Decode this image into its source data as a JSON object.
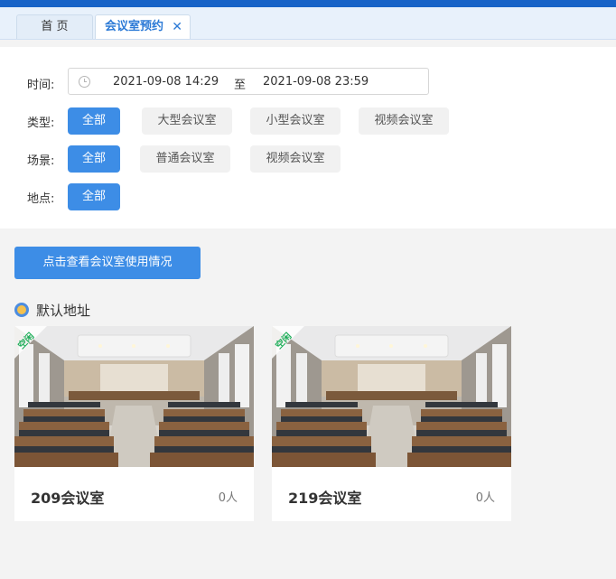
{
  "tabs": {
    "home_label": "首 页",
    "active_label": "会议室预约",
    "close_glyph": "✕"
  },
  "filters": {
    "time_label": "时间:",
    "time_start": "2021-09-08 14:29",
    "time_separator": "至",
    "time_end": "2021-09-08 23:59",
    "type_label": "类型:",
    "type_options": [
      "全部",
      "大型会议室",
      "小型会议室",
      "视频会议室"
    ],
    "scene_label": "场景:",
    "scene_options": [
      "全部",
      "普通会议室",
      "视频会议室"
    ],
    "location_label": "地点:",
    "location_options": [
      "全部"
    ]
  },
  "actions": {
    "view_usage_label": "点击查看会议室使用情况"
  },
  "address": {
    "title": "默认地址"
  },
  "rooms": [
    {
      "name": "209会议室",
      "count": "0人",
      "badge": "空闲"
    },
    {
      "name": "219会议室",
      "count": "0人",
      "badge": "空闲"
    }
  ],
  "colors": {
    "brand_blue": "#1763c7",
    "accent_blue": "#3d8de6",
    "badge_green": "#1fae5a"
  }
}
